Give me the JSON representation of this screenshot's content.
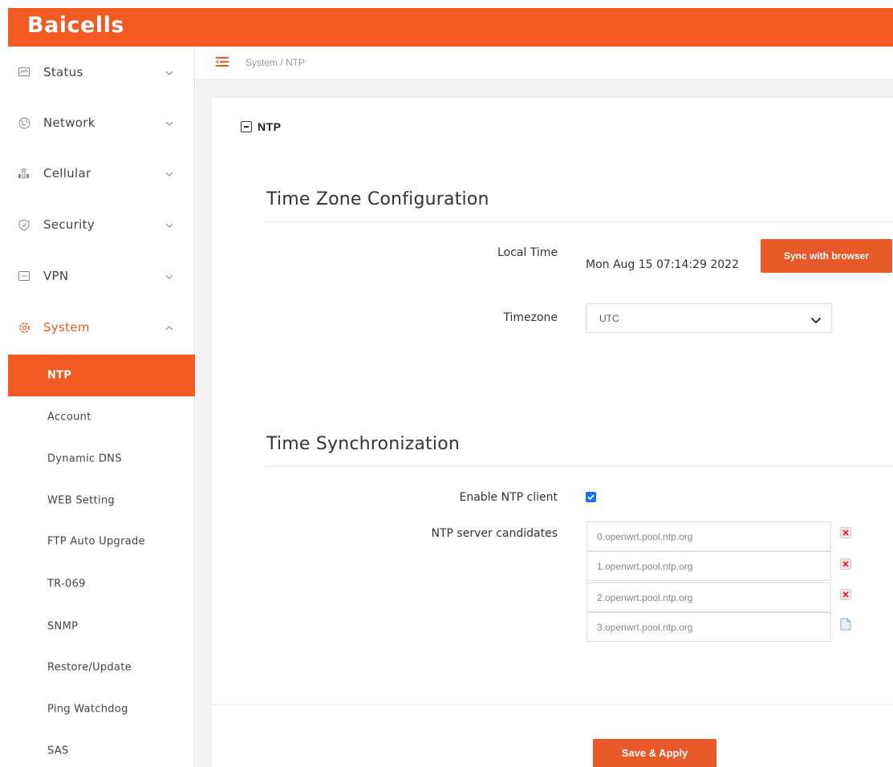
{
  "brand": {
    "logo_text": "Baicells",
    "accent_color": "#f15a22"
  },
  "sidebar": {
    "items": [
      {
        "label": "Status",
        "icon": "monitor-icon"
      },
      {
        "label": "Network",
        "icon": "globe-icon"
      },
      {
        "label": "Cellular",
        "icon": "cellular-icon"
      },
      {
        "label": "Security",
        "icon": "shield-icon"
      },
      {
        "label": "VPN",
        "icon": "vpn-icon"
      },
      {
        "label": "System",
        "icon": "gear-icon",
        "expanded": true
      }
    ],
    "system_submenu": [
      {
        "label": "NTP",
        "selected": true
      },
      {
        "label": "Account"
      },
      {
        "label": "Dynamic DNS"
      },
      {
        "label": "WEB Setting"
      },
      {
        "label": "FTP Auto Upgrade"
      },
      {
        "label": "TR-069"
      },
      {
        "label": "SNMP"
      },
      {
        "label": "Restore/Update"
      },
      {
        "label": "Ping Watchdog"
      },
      {
        "label": "SAS"
      }
    ]
  },
  "breadcrumb": {
    "text": "System / NTP"
  },
  "page": {
    "heading": "NTP",
    "timezone_section": {
      "title": "Time Zone Configuration",
      "local_time_label": "Local Time",
      "local_time_value": "Mon Aug 15 07:14:29 2022",
      "sync_button": "Sync with browser",
      "timezone_label": "Timezone",
      "timezone_value": "UTC"
    },
    "sync_section": {
      "title": "Time Synchronization",
      "enable_label": "Enable NTP client",
      "enable_checked": true,
      "servers_label": "NTP server candidates",
      "servers": [
        "0.openwrt.pool.ntp.org",
        "1.openwrt.pool.ntp.org",
        "2.openwrt.pool.ntp.org",
        "3.openwrt.pool.ntp.org"
      ]
    },
    "save_button": "Save & Apply"
  }
}
